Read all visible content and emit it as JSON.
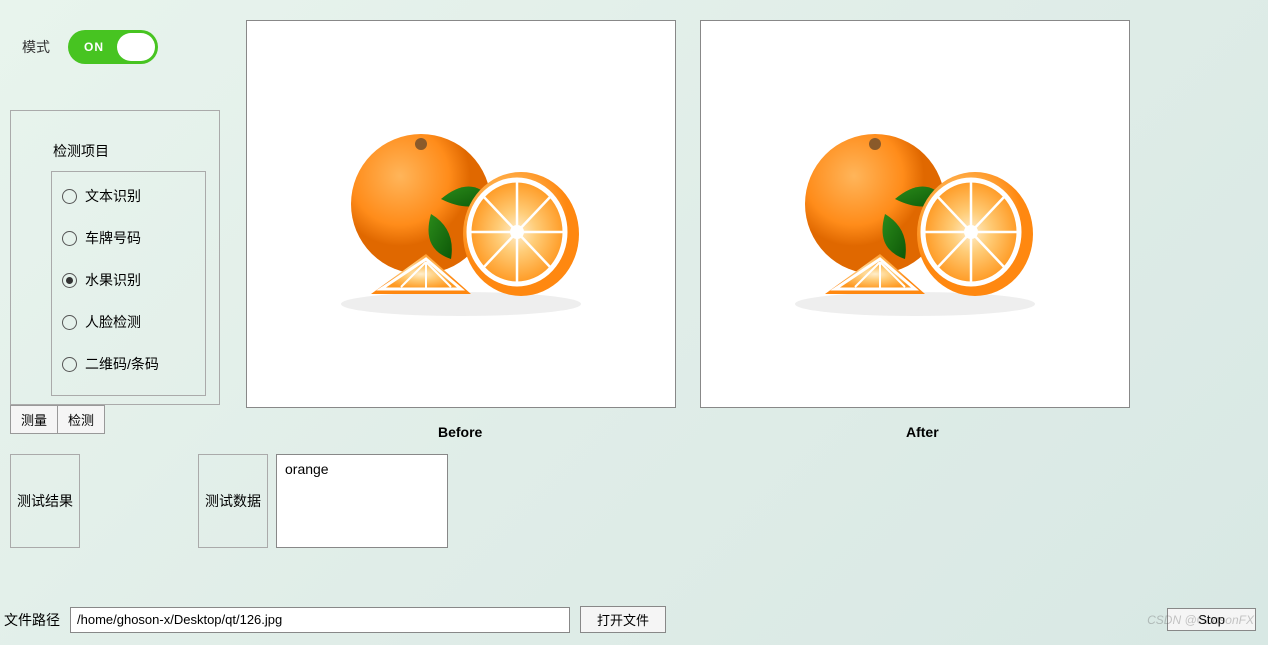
{
  "mode": {
    "label": "模式",
    "toggle_text": "ON",
    "state": true
  },
  "panel": {
    "title": "检测项目",
    "options": [
      {
        "label": "文本识别",
        "checked": false
      },
      {
        "label": "车牌号码",
        "checked": false
      },
      {
        "label": "水果识别",
        "checked": true
      },
      {
        "label": "人脸检测",
        "checked": false
      },
      {
        "label": "二维码/条码",
        "checked": false
      }
    ]
  },
  "tabs": {
    "measure": "测量",
    "detect": "检测"
  },
  "viewers": {
    "before_label": "Before",
    "after_label": "After"
  },
  "results": {
    "test_result_label": "测试结果",
    "test_data_label": "测试数据",
    "test_data_value": "orange"
  },
  "footer": {
    "path_label": "文件路径",
    "path_value": "/home/ghoson-x/Desktop/qt/126.jpg",
    "open_button": "打开文件",
    "stop_button": "Stop"
  },
  "watermark": "CSDN @GhosonFX"
}
